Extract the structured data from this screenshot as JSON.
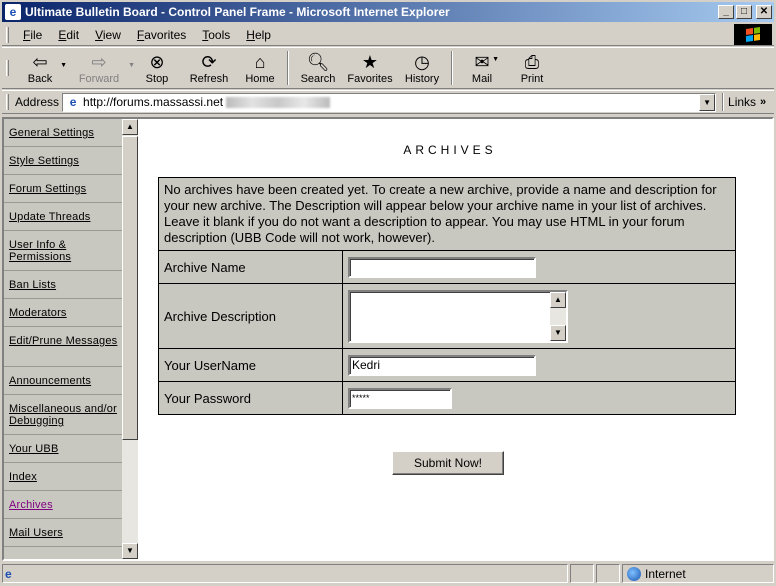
{
  "window": {
    "title": "Ultimate Bulletin Board - Control Panel Frame - Microsoft Internet Explorer",
    "minimize": "_",
    "maximize": "□",
    "close": "✕"
  },
  "menu": [
    "File",
    "Edit",
    "View",
    "Favorites",
    "Tools",
    "Help"
  ],
  "toolbar": {
    "back": "Back",
    "forward": "Forward",
    "stop": "Stop",
    "refresh": "Refresh",
    "home": "Home",
    "search": "Search",
    "favorites": "Favorites",
    "history": "History",
    "mail": "Mail",
    "print": "Print"
  },
  "address": {
    "label": "Address",
    "url": "http://forums.massassi.net",
    "links": "Links"
  },
  "sidebar": {
    "items": [
      {
        "label": "General Settings"
      },
      {
        "label": "Style Settings"
      },
      {
        "label": "Forum Settings"
      },
      {
        "label": "Update Threads"
      },
      {
        "label": "User Info & Permissions"
      },
      {
        "label": "Ban Lists"
      },
      {
        "label": "Moderators"
      },
      {
        "label": "Edit/Prune Messages"
      },
      {
        "label": "Announcements"
      },
      {
        "label": "Miscellaneous and/or Debugging"
      },
      {
        "label": "Your UBB"
      },
      {
        "label": "Index"
      },
      {
        "label": "Archives"
      },
      {
        "label": "Mail Users"
      }
    ],
    "active_item": "Archives"
  },
  "main": {
    "title": "ARCHIVES",
    "intro": "No archives have been created yet. To create a new archive, provide a name and description for your new archive. The Description will appear below your archive name in your list of archives. Leave it blank if you do not want a description to appear. You may use HTML in your forum description (UBB Code will not work, however).",
    "fields": {
      "archive_name_label": "Archive Name",
      "archive_name_value": "",
      "archive_description_label": "Archive Description",
      "archive_description_value": "",
      "username_label": "Your UserName",
      "username_value": "Kedri",
      "password_label": "Your Password",
      "password_value": "*****"
    },
    "submit_label": "Submit Now!"
  },
  "status": {
    "text": "",
    "zone": "Internet"
  }
}
